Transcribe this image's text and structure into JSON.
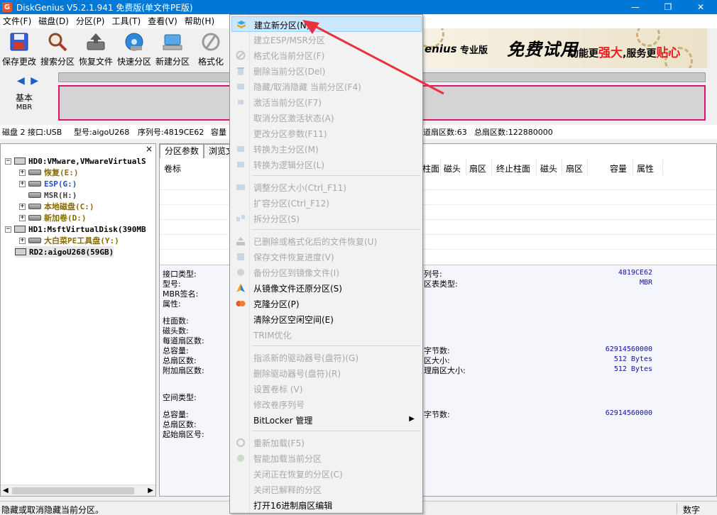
{
  "window": {
    "title": "DiskGenius V5.2.1.941 免费版(单文件PE版)",
    "app_icon_letter": "G",
    "minimize_glyph": "—",
    "maximize_glyph": "❐",
    "close_glyph": "✕"
  },
  "menubar": [
    {
      "label": "文件(F)"
    },
    {
      "label": "磁盘(D)"
    },
    {
      "label": "分区(P)"
    },
    {
      "label": "工具(T)"
    },
    {
      "label": "查看(V)"
    },
    {
      "label": "帮助(H)"
    }
  ],
  "toolbar": [
    {
      "label": "保存更改",
      "icon": "save-icon"
    },
    {
      "label": "搜索分区",
      "icon": "magnifier-icon"
    },
    {
      "label": "恢复文件",
      "icon": "recover-file-icon"
    },
    {
      "label": "快速分区",
      "icon": "quick-partition-icon"
    },
    {
      "label": "新建分区",
      "icon": "new-partition-icon"
    },
    {
      "label": "格式化",
      "icon": "format-icon"
    }
  ],
  "banner": {
    "brand": "enius",
    "edition": "专业版",
    "free_try": "免费试用",
    "slogan_a": "功能更",
    "slogan_b": "强大",
    "slogan_c": ",服务更",
    "slogan_d": "贴心"
  },
  "disk_panel": {
    "nav_left": "◀",
    "nav_right": "▶",
    "type_line1": "基本",
    "type_line2": "MBR"
  },
  "infoline": {
    "disk": "磁盘 2 接口:USB",
    "model": "型号:aigoU268",
    "serial": "序列号:4819CE62",
    "capacity": "容量",
    "sectors_per_track": "道扇区数:63",
    "total_sectors": "总扇区数:122880000"
  },
  "tree": {
    "close_glyph": "×",
    "items": [
      {
        "label": "HD0:VMware,VMwareVirtualS",
        "color": "#000000"
      },
      {
        "label": "恢复(E:)",
        "color": "#8b6b00"
      },
      {
        "label": "ESP(G:)",
        "color": "#2050c0"
      },
      {
        "label": "MSR(H:)",
        "color": "#404040"
      },
      {
        "label": "本地磁盘(C:)",
        "color": "#8b6b00"
      },
      {
        "label": "新加卷(D:)",
        "color": "#8b6b00"
      },
      {
        "label": "HD1:MsftVirtualDisk(390MB",
        "color": "#000000"
      },
      {
        "label": "大白菜PE工具盘(Y:)",
        "color": "#8b6b00"
      },
      {
        "label": "RD2:aigoU268(59GB)",
        "color": "#000000"
      }
    ]
  },
  "tabs": [
    {
      "label": "分区参数"
    },
    {
      "label": "浏览文"
    }
  ],
  "columns": {
    "volume": "卷标",
    "cyl": "柱面",
    "head": "磁头",
    "sector": "扇区",
    "end_cyl": "终止柱面",
    "end_head": "磁头",
    "end_sector": "扇区",
    "capacity": "容量",
    "attr": "属性"
  },
  "details": {
    "interface_type": "接口类型:",
    "model": "型号:",
    "mbr_sig": "MBR签名:",
    "attr": "属性:",
    "cylinders": "柱面数:",
    "heads": "磁头数:",
    "sectors_per_track": "每道扇区数:",
    "total_capacity": "总容量:",
    "total_sectors": "总扇区数:",
    "extra_sectors": "附加扇区数:",
    "space_type": "空间类型:",
    "total_capacity2": "总容量:",
    "total_sectors2": "总扇区数:",
    "start_sector": "起始扇区号:",
    "serial_label": "列号:",
    "serial_value": "4819CE62",
    "pt_type_label": "区表类型:",
    "pt_type_value": "MBR",
    "total_bytes_label": "字节数:",
    "total_bytes_value": "62914560000",
    "sector_size_label": "区大小:",
    "sector_size_value": "512 Bytes",
    "phys_sector_label": "理扇区大小:",
    "phys_sector_value": "512 Bytes",
    "total_bytes2_label": "字节数:",
    "total_bytes2_value": "62914560000"
  },
  "statusbar": {
    "message": "隐藏或取消隐藏当前分区。",
    "mode": "数字"
  },
  "context_menu": {
    "items": [
      {
        "label": "建立新分区(N)",
        "enabled": true,
        "icon": "new-partition-icon"
      },
      {
        "label": "建立ESP/MSR分区",
        "enabled": false,
        "icon": ""
      },
      {
        "label": "格式化当前分区(F)",
        "enabled": false,
        "icon": "format-icon"
      },
      {
        "label": "删除当前分区(Del)",
        "enabled": false,
        "icon": "trash-icon"
      },
      {
        "label": "隐藏/取消隐藏 当前分区(F4)",
        "enabled": false,
        "icon": "hide-icon"
      },
      {
        "label": "激活当前分区(F7)",
        "enabled": false,
        "icon": "activate-icon"
      },
      {
        "label": "取消分区激活状态(A)",
        "enabled": false,
        "icon": ""
      },
      {
        "label": "更改分区参数(F11)",
        "enabled": false,
        "icon": ""
      },
      {
        "label": "转换为主分区(M)",
        "enabled": false,
        "icon": "convert-icon"
      },
      {
        "label": "转换为逻辑分区(L)",
        "enabled": false,
        "icon": "convert-icon"
      },
      {
        "label": "调整分区大小(Ctrl_F11)",
        "enabled": false,
        "icon": "resize-icon"
      },
      {
        "label": "扩容分区(Ctrl_F12)",
        "enabled": false,
        "icon": ""
      },
      {
        "label": "拆分分区(S)",
        "enabled": false,
        "icon": "split-icon"
      },
      {
        "label": "已删除或格式化后的文件恢复(U)",
        "enabled": false,
        "icon": "recover-file-icon"
      },
      {
        "label": "保存文件恢复进度(V)",
        "enabled": false,
        "icon": "save-progress-icon"
      },
      {
        "label": "备份分区到镜像文件(I)",
        "enabled": false,
        "icon": "backup-icon"
      },
      {
        "label": "从镜像文件还原分区(S)",
        "enabled": true,
        "icon": "restore-icon"
      },
      {
        "label": "克隆分区(P)",
        "enabled": true,
        "icon": "clone-icon"
      },
      {
        "label": "清除分区空闲空间(E)",
        "enabled": true,
        "icon": ""
      },
      {
        "label": "TRIM优化",
        "enabled": false,
        "icon": ""
      },
      {
        "label": "指派新的驱动器号(盘符)(G)",
        "enabled": false,
        "icon": ""
      },
      {
        "label": "删除驱动器号(盘符)(R)",
        "enabled": false,
        "icon": ""
      },
      {
        "label": "设置卷标 (V)",
        "enabled": false,
        "icon": ""
      },
      {
        "label": "修改卷序列号",
        "enabled": false,
        "icon": ""
      },
      {
        "label": "BitLocker 管理",
        "enabled": true,
        "icon": "",
        "submenu": true,
        "submenu_arrow": "▶"
      },
      {
        "label": "重新加载(F5)",
        "enabled": false,
        "icon": "reload-icon"
      },
      {
        "label": "智能加载当前分区",
        "enabled": false,
        "icon": "smart-load-icon"
      },
      {
        "label": "关闭正在恢复的分区(C)",
        "enabled": false,
        "icon": ""
      },
      {
        "label": "关闭已解释的分区",
        "enabled": false,
        "icon": ""
      },
      {
        "label": "打开16进制扇区编辑",
        "enabled": true,
        "icon": ""
      }
    ]
  },
  "colors": {
    "titlebar": "#0078d7",
    "highlight": "#cce8ff",
    "disk_border": "#e1136b",
    "annotation": "#e8323c"
  }
}
